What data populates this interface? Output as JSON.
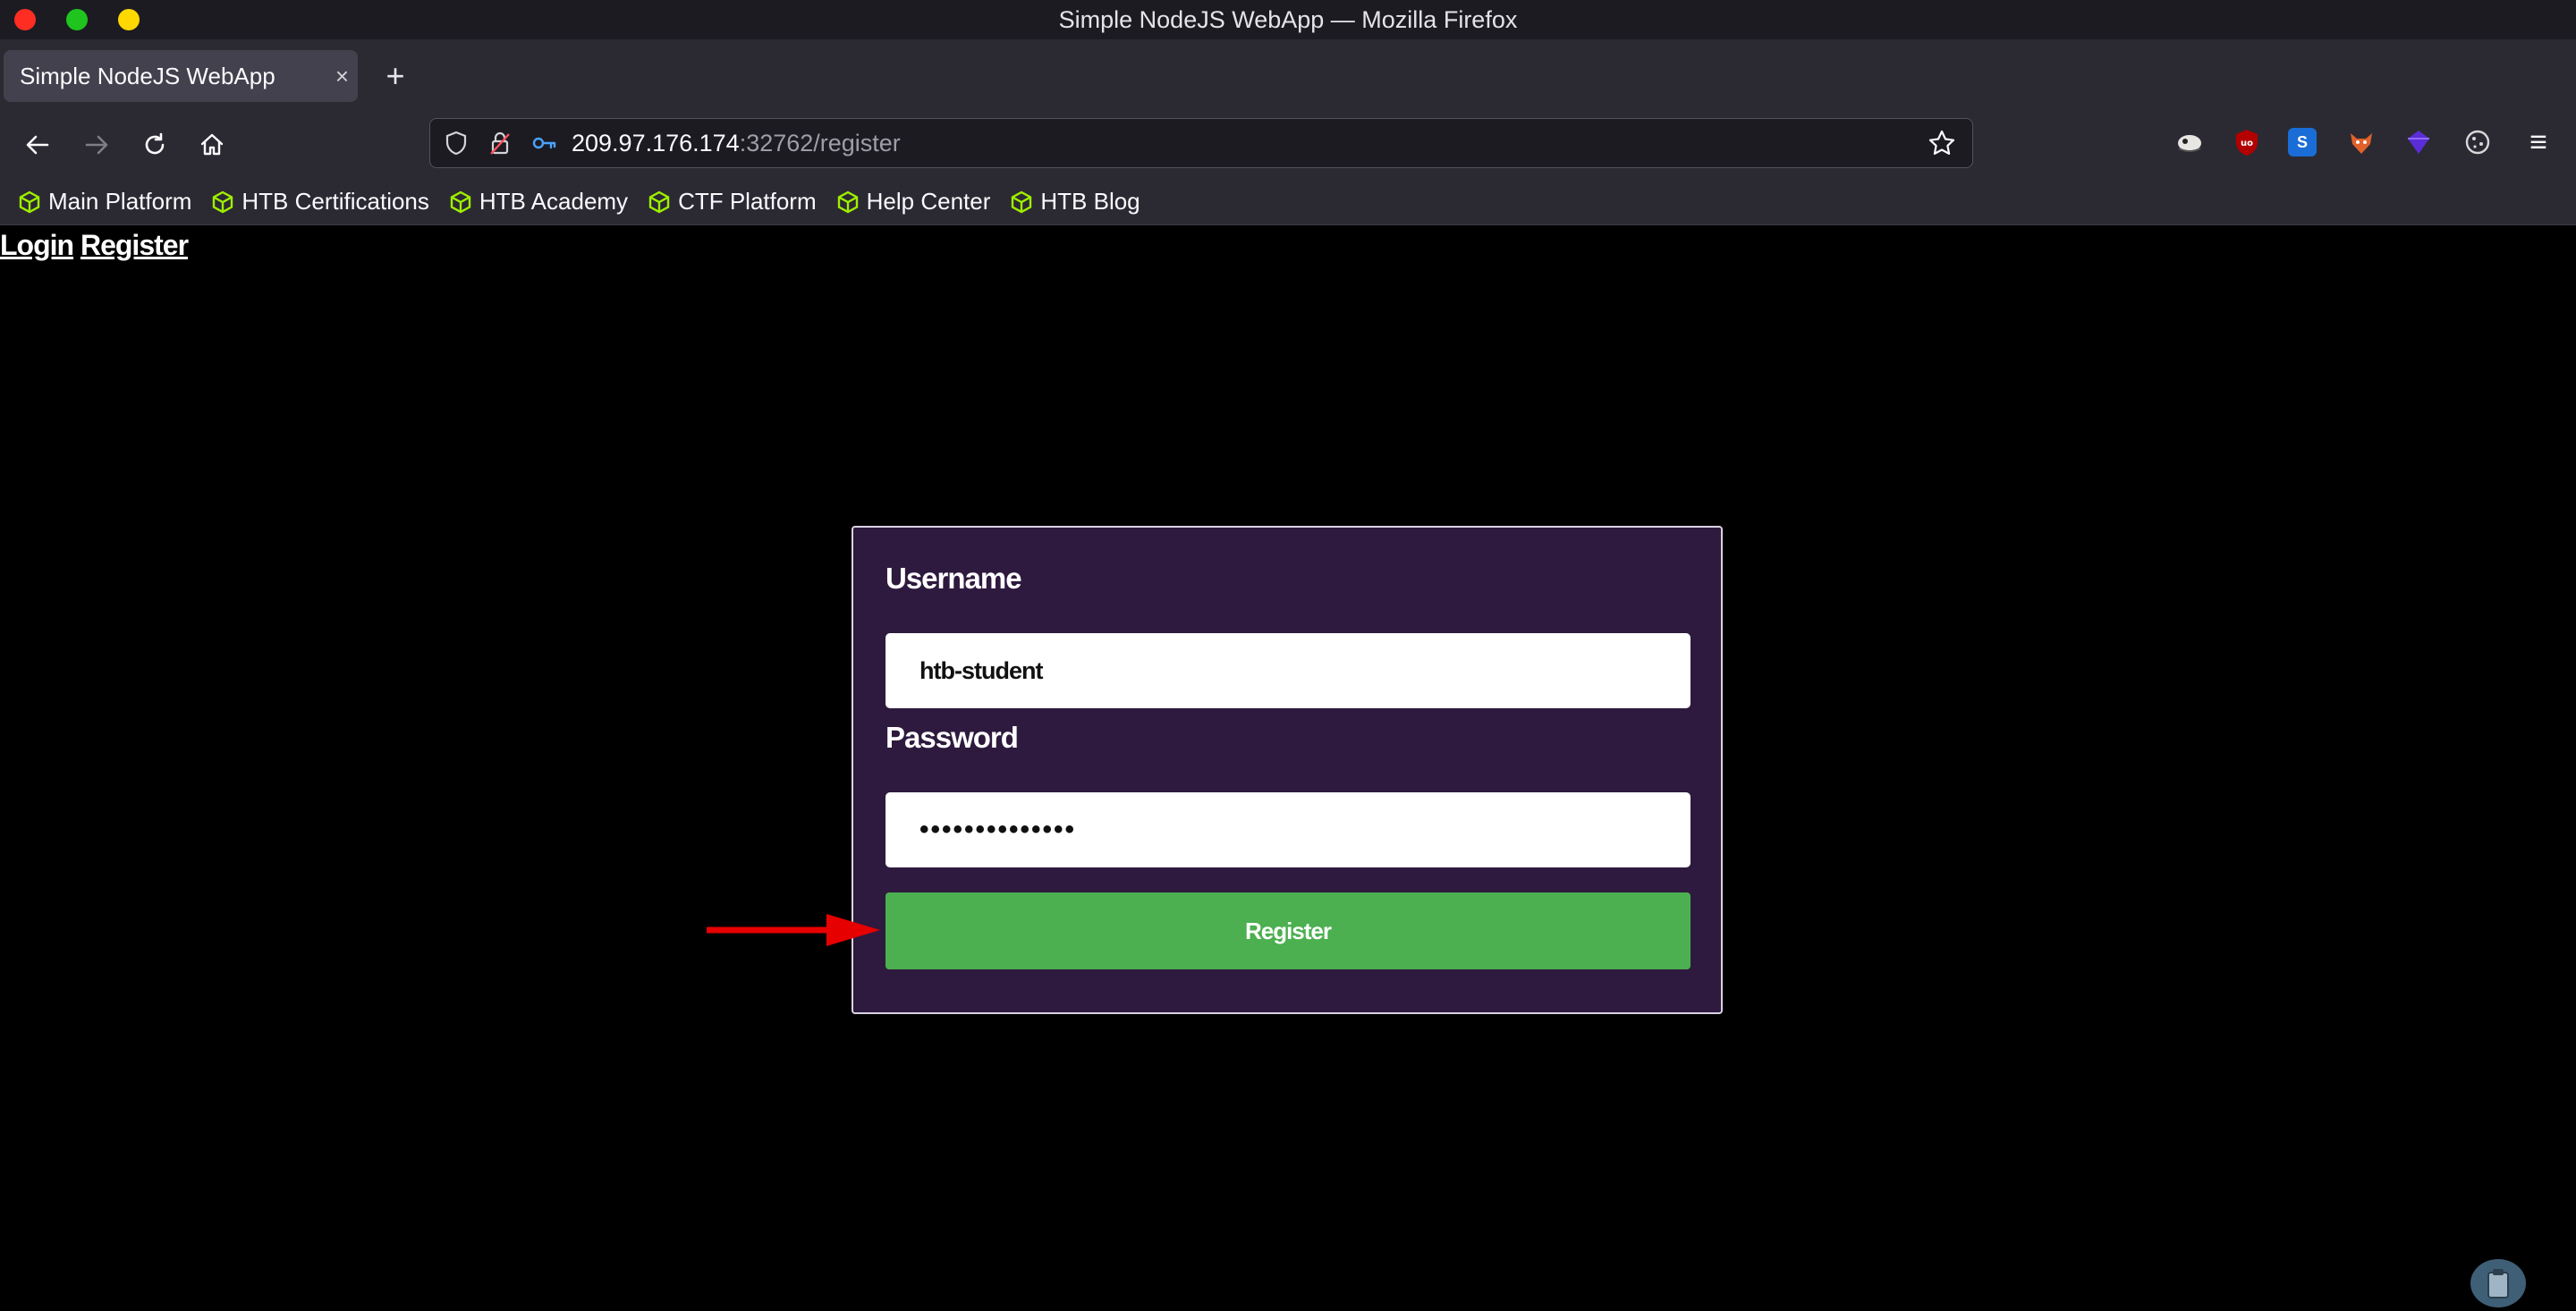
{
  "window": {
    "title": "Simple NodeJS WebApp — Mozilla Firefox",
    "controls": {
      "close_color": "#ff2d22",
      "minimize_color": "#1fc41f",
      "maximize_color": "#ffd800"
    }
  },
  "tabs": [
    {
      "title": "Simple NodeJS WebApp",
      "close_glyph": "×",
      "active": true
    }
  ],
  "new_tab_glyph": "+",
  "navbar": {
    "url_host": "209.97.176.174",
    "url_rest": ":32762/register",
    "icons": [
      "back-icon",
      "forward-icon",
      "reload-icon",
      "home-icon",
      "shield-icon",
      "lock-icon",
      "key-icon",
      "star-icon"
    ],
    "extensions": [
      {
        "name": "chameleon-extension-icon",
        "glyph": "☁",
        "color": "#e8e6e3"
      },
      {
        "name": "ublock-extension-icon",
        "glyph": "uo",
        "color": "#b30000"
      },
      {
        "name": "s-extension-icon",
        "glyph": "S",
        "color": "#1a6dd7"
      },
      {
        "name": "foxyproxy-extension-icon",
        "glyph": "🦊",
        "color": "#e0612a"
      },
      {
        "name": "wappalyzer-extension-icon",
        "glyph": "◆",
        "color": "#5a2dd8"
      },
      {
        "name": "cookie-extension-icon",
        "glyph": "🍪",
        "color": "#d8d8d8"
      }
    ],
    "menu_glyph": "≡"
  },
  "bookmarks": [
    {
      "label": "Main Platform"
    },
    {
      "label": "HTB Certifications"
    },
    {
      "label": "HTB Academy"
    },
    {
      "label": "CTF Platform"
    },
    {
      "label": "Help Center"
    },
    {
      "label": "HTB Blog"
    }
  ],
  "bookmark_icon_color": "#9fef00",
  "page": {
    "links": {
      "login": "Login",
      "register": "Register"
    },
    "form": {
      "username_label": "Username",
      "username_value": "htb-student",
      "password_label": "Password",
      "password_mask": "••••••••••••••",
      "submit_label": "Register"
    },
    "annotation_color": "#e60000"
  }
}
